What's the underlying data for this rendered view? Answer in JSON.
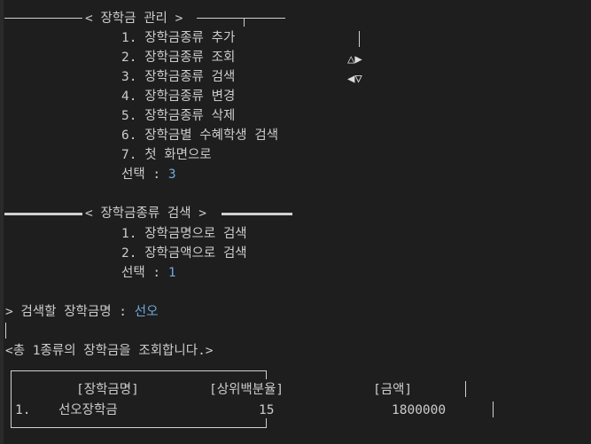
{
  "menu1": {
    "title": "< 장학금 관리 >",
    "items": [
      "1. 장학금종류 추가",
      "2. 장학금종류 조회",
      "3. 장학금종류 검색",
      "4. 장학금종류 변경",
      "5. 장학금종류 삭제",
      "6. 장학금별 수혜학생 검색",
      "7. 첫 화면으로"
    ],
    "select_label": "선택 : ",
    "select_value": "3"
  },
  "menu2": {
    "title": "< 장학금종류 검색 >",
    "items": [
      "1. 장학금명으로 검색",
      "2. 장학금액으로 검색"
    ],
    "select_label": "선택 : ",
    "select_value": "1"
  },
  "search": {
    "prompt": "> 검색할 장학금명 : ",
    "value": "선오"
  },
  "summary": "<총 1종류의 장학금을 조회합니다.>",
  "table": {
    "headers": [
      "[장학금명]",
      "[상위백분율]",
      "[금액]"
    ],
    "rows": [
      {
        "no": "1.",
        "name": "선오장학금",
        "percent": "15",
        "amount": "1800000"
      }
    ]
  },
  "colors": {
    "background": "#1e1e1e",
    "text": "#cccccc",
    "input": "#6fa8dc"
  },
  "icons": [
    "arrow-up-right-icon",
    "arrow-left-down-icon"
  ]
}
